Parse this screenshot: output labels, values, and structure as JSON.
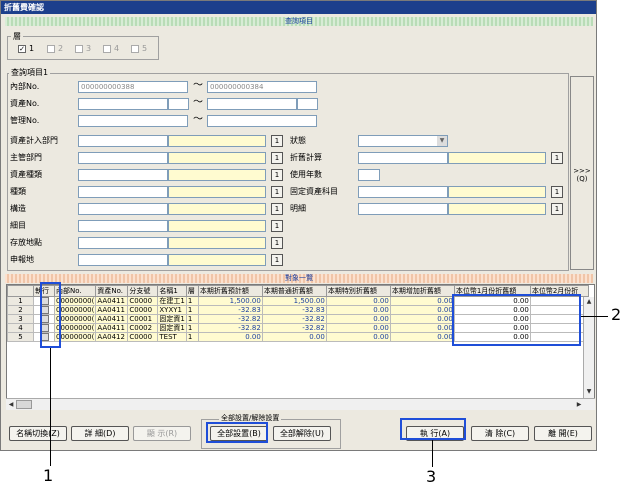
{
  "window": {
    "title": "折舊費確認"
  },
  "section": {
    "query_band": "查詢項目",
    "list_band": "對象一覽"
  },
  "layer": {
    "label": "層",
    "items": [
      {
        "label": "1",
        "checked": true,
        "enabled": true
      },
      {
        "label": "2",
        "checked": false,
        "enabled": false
      },
      {
        "label": "3",
        "checked": false,
        "enabled": false
      },
      {
        "label": "4",
        "checked": false,
        "enabled": false
      },
      {
        "label": "5",
        "checked": false,
        "enabled": false
      }
    ]
  },
  "query": {
    "group_label": "查詢項目1",
    "internal_no_label": "內部No.",
    "internal_no_from": "000000000388",
    "internal_no_to": "000000000384",
    "asset_no_label": "資產No.",
    "mgmt_no_label": "管理No.",
    "tilde": "～",
    "dept_label": "資產計入部門",
    "main_dept_label": "主管部門",
    "asset_type_label": "資產種類",
    "kind_label": "種類",
    "structure_label": "構造",
    "detail_label": "細目",
    "location_label": "存放地點",
    "reporter_label": "申報地",
    "status_label": "狀態",
    "depr_calc_label": "折舊計算",
    "useful_life_label": "使用年數",
    "fixed_asset_label": "固定資產科目",
    "breakdown_label": "明細",
    "lookup_btn": "1",
    "expand_btn": ">>>",
    "expand_key": "(Q)"
  },
  "table": {
    "headers": [
      "執行",
      "內部No.",
      "資產No.",
      "分支號",
      "名稱1",
      "層",
      "本期折舊預計額",
      "本期普通折舊額",
      "本期特別折舊額",
      "本期增加折舊額",
      "本位幣1月份折舊額",
      "本位幣2月份折"
    ],
    "rows": [
      {
        "n": "1",
        "internal": "00000000(",
        "asset": "AA0411",
        "branch": "C0000",
        "name": "在建工1",
        "layer": "1",
        "plan": "1,500.00",
        "normal": "1,500.00",
        "special": "0.00",
        "extra": "0.00",
        "m1": "0.00"
      },
      {
        "n": "2",
        "internal": "00000000(",
        "asset": "AA0411",
        "branch": "C0000",
        "name": "XYXY1",
        "layer": "1",
        "plan": "-32.83",
        "normal": "-32.83",
        "special": "0.00",
        "extra": "0.00",
        "m1": "0.00"
      },
      {
        "n": "3",
        "internal": "00000000(",
        "asset": "AA0411",
        "branch": "C0001",
        "name": "固定資1",
        "layer": "1",
        "plan": "-32.82",
        "normal": "-32.82",
        "special": "0.00",
        "extra": "0.00",
        "m1": "0.00"
      },
      {
        "n": "4",
        "internal": "00000000(",
        "asset": "AA0411",
        "branch": "C0002",
        "name": "固定資1",
        "layer": "1",
        "plan": "-32.82",
        "normal": "-32.82",
        "special": "0.00",
        "extra": "0.00",
        "m1": "0.00"
      },
      {
        "n": "5",
        "internal": "00000000(",
        "asset": "AA0412",
        "branch": "C0000",
        "name": "TEST",
        "layer": "1",
        "plan": "0.00",
        "normal": "0.00",
        "special": "0.00",
        "extra": "0.00",
        "m1": "0.00"
      }
    ]
  },
  "footer": {
    "name_switch": "名稱切換(Z)",
    "detail": "詳 細(D)",
    "display": "顯 示(R)",
    "all_target_group": "全部設置/解除設置",
    "set_all": "全部設置(B)",
    "release_all": "全部解除(U)",
    "execute": "執 行(A)",
    "clear": "清 除(C)",
    "close": "離 開(E)"
  },
  "callouts": {
    "one": "1",
    "two": "2",
    "three": "3"
  },
  "colors": {
    "title_bar": "#1c3f8c",
    "callout": "#1f4ed8",
    "highlight": "#fffbd0"
  }
}
